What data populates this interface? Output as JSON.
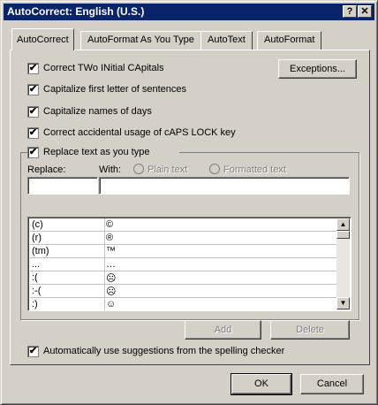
{
  "window": {
    "title": "AutoCorrect: English (U.S.)",
    "help_glyph": "?",
    "close_glyph": "✕"
  },
  "tabs": [
    {
      "label": "AutoCorrect",
      "active": true
    },
    {
      "label": "AutoFormat As You Type",
      "active": false
    },
    {
      "label": "AutoText",
      "active": false
    },
    {
      "label": "AutoFormat",
      "active": false
    }
  ],
  "options": {
    "correct_two_initial_capitals": {
      "label": "Correct TWo INitial CApitals",
      "checked": true
    },
    "capitalize_first_letter": {
      "label": "Capitalize first letter of sentences",
      "checked": true
    },
    "capitalize_days": {
      "label": "Capitalize names of days",
      "checked": true
    },
    "correct_caps_lock": {
      "label": "Correct accidental usage of cAPS LOCK key",
      "checked": true
    },
    "replace_as_you_type": {
      "label": "Replace text as you type",
      "checked": true
    },
    "auto_suggestions": {
      "label": "Automatically use suggestions from the spelling checker",
      "checked": true
    }
  },
  "check_glyph": "✔",
  "exceptions_button": "Exceptions...",
  "replace_label": "Replace:",
  "with_label": "With:",
  "plain_text_label": "Plain text",
  "formatted_text_label": "Formatted text",
  "replace_value": "",
  "with_value": "",
  "entries": [
    {
      "replace": "(c)",
      "with": "©"
    },
    {
      "replace": "(r)",
      "with": "®"
    },
    {
      "replace": "(tm)",
      "with": "™"
    },
    {
      "replace": "...",
      "with": "…"
    },
    {
      "replace": ":(",
      "with": "☹"
    },
    {
      "replace": ":-(",
      "with": "☹"
    },
    {
      "replace": ":)",
      "with": "☺"
    }
  ],
  "scroll": {
    "up_glyph": "▲",
    "down_glyph": "▼"
  },
  "add_button": "Add",
  "delete_button": "Delete",
  "ok_button": "OK",
  "cancel_button": "Cancel"
}
